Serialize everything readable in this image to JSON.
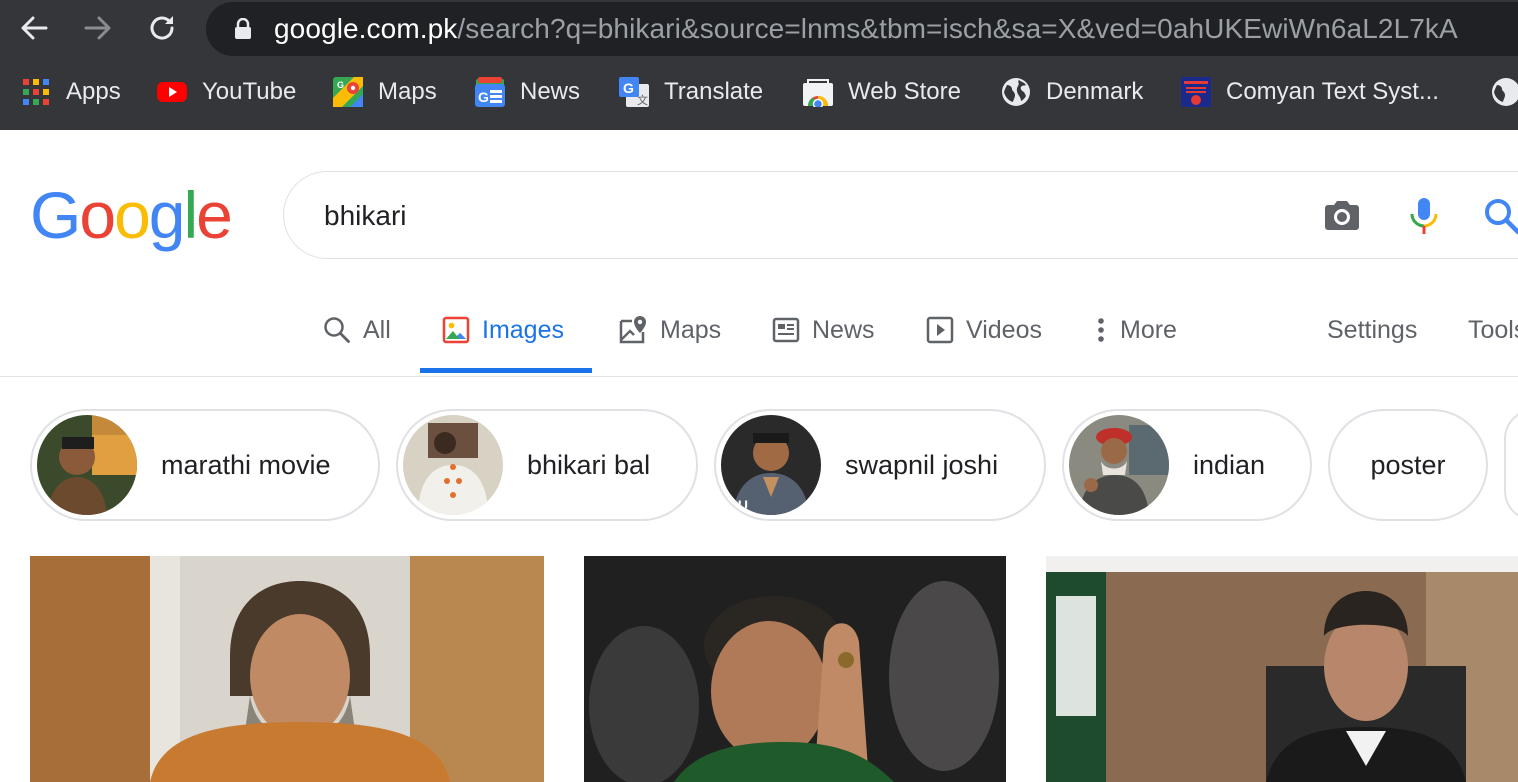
{
  "browser": {
    "url_domain": "google.com.pk",
    "url_path": "/search?q=bhikari&source=lnms&tbm=isch&sa=X&ved=0ahUKEwiWn6aL2L7kA",
    "bookmarks": [
      {
        "label": "Apps",
        "icon": "apps-grid-icon"
      },
      {
        "label": "YouTube",
        "icon": "youtube-icon"
      },
      {
        "label": "Maps",
        "icon": "maps-icon"
      },
      {
        "label": "News",
        "icon": "news-icon"
      },
      {
        "label": "Translate",
        "icon": "translate-icon"
      },
      {
        "label": "Web Store",
        "icon": "web-store-icon"
      },
      {
        "label": "Denmark",
        "icon": "globe-icon"
      },
      {
        "label": "Comyan Text Syst...",
        "icon": "comyan-icon"
      }
    ]
  },
  "search": {
    "logo": "Google",
    "query": "bhikari"
  },
  "tabs": [
    {
      "label": "All",
      "icon": "search-icon",
      "active": false
    },
    {
      "label": "Images",
      "icon": "image-icon",
      "active": true
    },
    {
      "label": "Maps",
      "icon": "map-pin-icon",
      "active": false
    },
    {
      "label": "News",
      "icon": "newspaper-icon",
      "active": false
    },
    {
      "label": "Videos",
      "icon": "play-icon",
      "active": false
    },
    {
      "label": "More",
      "icon": "more-vert-icon",
      "active": false
    }
  ],
  "tools": {
    "settings": "Settings",
    "tools": "Tools"
  },
  "chips": [
    {
      "label": "marathi movie"
    },
    {
      "label": "bhikari bal"
    },
    {
      "label": "swapnil joshi"
    },
    {
      "label": "indian"
    },
    {
      "label": "poster"
    }
  ],
  "colors": {
    "accent": "#1a73e8",
    "chrome_bg": "#35363a",
    "omnibox_bg": "#202124",
    "google_blue": "#4285f4",
    "google_red": "#ea4335",
    "google_yellow": "#fbbc05",
    "google_green": "#34a853"
  }
}
